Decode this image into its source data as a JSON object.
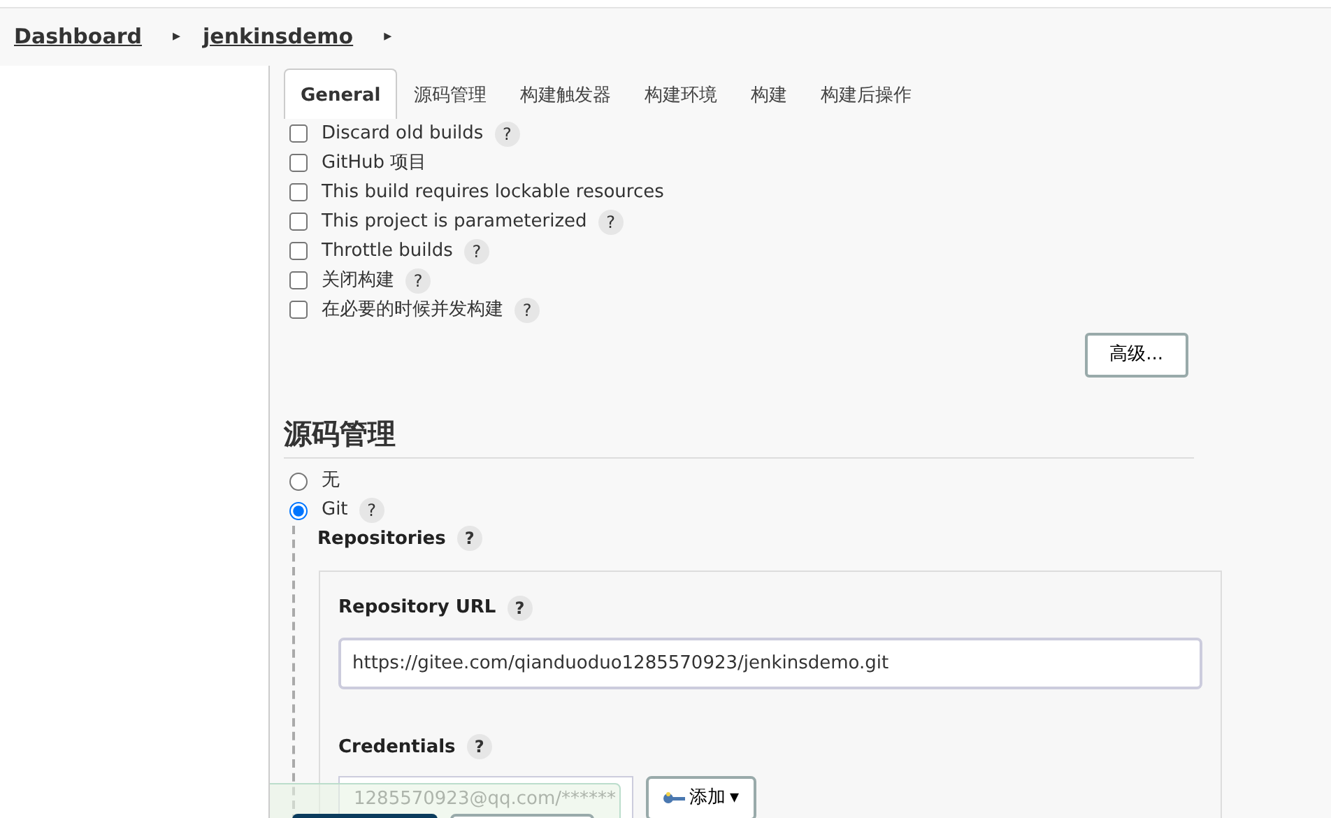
{
  "breadcrumb": [
    {
      "label": "Dashboard",
      "separator": "▸"
    },
    {
      "label": "jenkinsdemo",
      "separator": "▸"
    }
  ],
  "tabs": [
    {
      "label": "General",
      "selected": true
    },
    {
      "label": "源码管理",
      "selected": false
    },
    {
      "label": "构建触发器",
      "selected": false
    },
    {
      "label": "构建环境",
      "selected": false
    },
    {
      "label": "构建",
      "selected": false
    },
    {
      "label": "构建后操作",
      "selected": false
    }
  ],
  "options": [
    {
      "label": "Discard old builds",
      "checked": false,
      "help": "?"
    },
    {
      "label": "GitHub 项目",
      "checked": false
    },
    {
      "label": "This build requires lockable resources",
      "checked": false
    },
    {
      "label": "This project is parameterized",
      "checked": false,
      "help": "?"
    },
    {
      "label": "Throttle builds",
      "checked": false,
      "help": "?"
    },
    {
      "label": "关闭构建",
      "checked": false,
      "help": "?"
    },
    {
      "label": "在必要的时候并发构建",
      "checked": false,
      "help": "?"
    }
  ],
  "advanced_button": "高级...",
  "scm": {
    "title": "源码管理",
    "choices": [
      {
        "label": "无",
        "selected": false
      },
      {
        "label": "Git",
        "selected": true,
        "help": "?"
      }
    ],
    "repositories": {
      "label": "Repositories",
      "help": "?"
    },
    "repository_url": {
      "label": "Repository URL",
      "help": "?",
      "value": "https://gitee.com/qianduoduo1285570923/jenkinsdemo.git"
    },
    "credentials": {
      "label": "Credentials",
      "help": "?",
      "value": "1285570923@qq.com/******",
      "add_button": "添加",
      "caret": "▾"
    }
  }
}
